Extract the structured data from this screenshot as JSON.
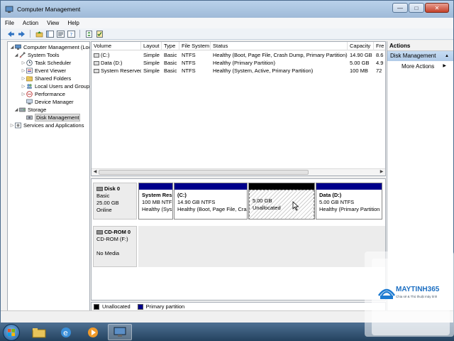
{
  "window": {
    "title": "Computer Management"
  },
  "menu": [
    "File",
    "Action",
    "View",
    "Help"
  ],
  "tree": {
    "root": "Computer Management (Local)",
    "system_tools": "System Tools",
    "task_scheduler": "Task Scheduler",
    "event_viewer": "Event Viewer",
    "shared_folders": "Shared Folders",
    "local_users": "Local Users and Groups",
    "performance": "Performance",
    "device_manager": "Device Manager",
    "storage": "Storage",
    "disk_management": "Disk Management",
    "services": "Services and Applications"
  },
  "volumes": {
    "columns": [
      "Volume",
      "Layout",
      "Type",
      "File System",
      "Status",
      "Capacity",
      "Fre"
    ],
    "rows": [
      {
        "volume": "(C:)",
        "layout": "Simple",
        "type": "Basic",
        "fs": "NTFS",
        "status": "Healthy (Boot, Page File, Crash Dump, Primary Partition)",
        "capacity": "14.90 GB",
        "free": "8.6"
      },
      {
        "volume": "Data (D:)",
        "layout": "Simple",
        "type": "Basic",
        "fs": "NTFS",
        "status": "Healthy (Primary Partition)",
        "capacity": "5.00 GB",
        "free": "4.9"
      },
      {
        "volume": "System Reserved",
        "layout": "Simple",
        "type": "Basic",
        "fs": "NTFS",
        "status": "Healthy (System, Active, Primary Partition)",
        "capacity": "100 MB",
        "free": "72"
      }
    ]
  },
  "disks": [
    {
      "name": "Disk 0",
      "kind": "Basic",
      "size": "25.00 GB",
      "state": "Online",
      "partitions": [
        {
          "name": "System Res",
          "size": "100 MB NTF",
          "status": "Healthy (Sys",
          "unallocated": false
        },
        {
          "name": "(C:)",
          "size": "14.90 GB NTFS",
          "status": "Healthy (Boot, Page File, Cras",
          "unallocated": false
        },
        {
          "name": "",
          "size": "5.00 GB",
          "status": "Unallocated",
          "unallocated": true
        },
        {
          "name": "Data  (D:)",
          "size": "5.00 GB NTFS",
          "status": "Healthy (Primary Partition",
          "unallocated": false
        }
      ]
    },
    {
      "name": "CD-ROM 0",
      "kind": "CD-ROM (F:)",
      "size": "",
      "state": "No Media",
      "partitions": []
    }
  ],
  "legend": [
    {
      "label": "Unallocated",
      "color": "#000000"
    },
    {
      "label": "Primary partition",
      "color": "#00008b"
    }
  ],
  "actions": {
    "title": "Actions",
    "group": "Disk Management",
    "items": [
      "More Actions"
    ]
  },
  "watermark": {
    "brand": "MAYTINH365",
    "tagline": "Chia sẻ & Thủ thuật máy tính"
  }
}
